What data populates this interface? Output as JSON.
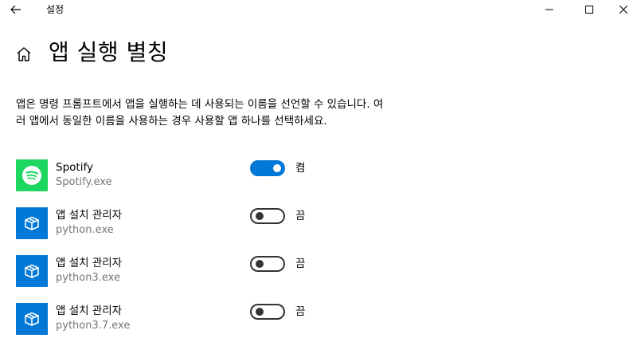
{
  "window": {
    "title": "설정"
  },
  "page": {
    "title": "앱 실행 별칭",
    "description": "앱은 명령 프롬프트에서 앱을 실행하는 데 사용되는 이름을 선언할 수 있습니다. 여러 앱에서 동일한 이름을 사용하는 경우 사용할 앱 하나를 선택하세요."
  },
  "colors": {
    "accent": "#0078d7",
    "spotify": "#1ed760",
    "installer_tile": "#0078d7",
    "secondary_text": "#767676"
  },
  "aliases": [
    {
      "name": "Spotify",
      "exe": "Spotify.exe",
      "enabled": true,
      "state_label": "켬",
      "icon": "spotify-icon"
    },
    {
      "name": "앱 설치 관리자",
      "exe": "python.exe",
      "enabled": false,
      "state_label": "끔",
      "icon": "app-installer-icon"
    },
    {
      "name": "앱 설치 관리자",
      "exe": "python3.exe",
      "enabled": false,
      "state_label": "끔",
      "icon": "app-installer-icon"
    },
    {
      "name": "앱 설치 관리자",
      "exe": "python3.7.exe",
      "enabled": false,
      "state_label": "끔",
      "icon": "app-installer-icon"
    }
  ]
}
